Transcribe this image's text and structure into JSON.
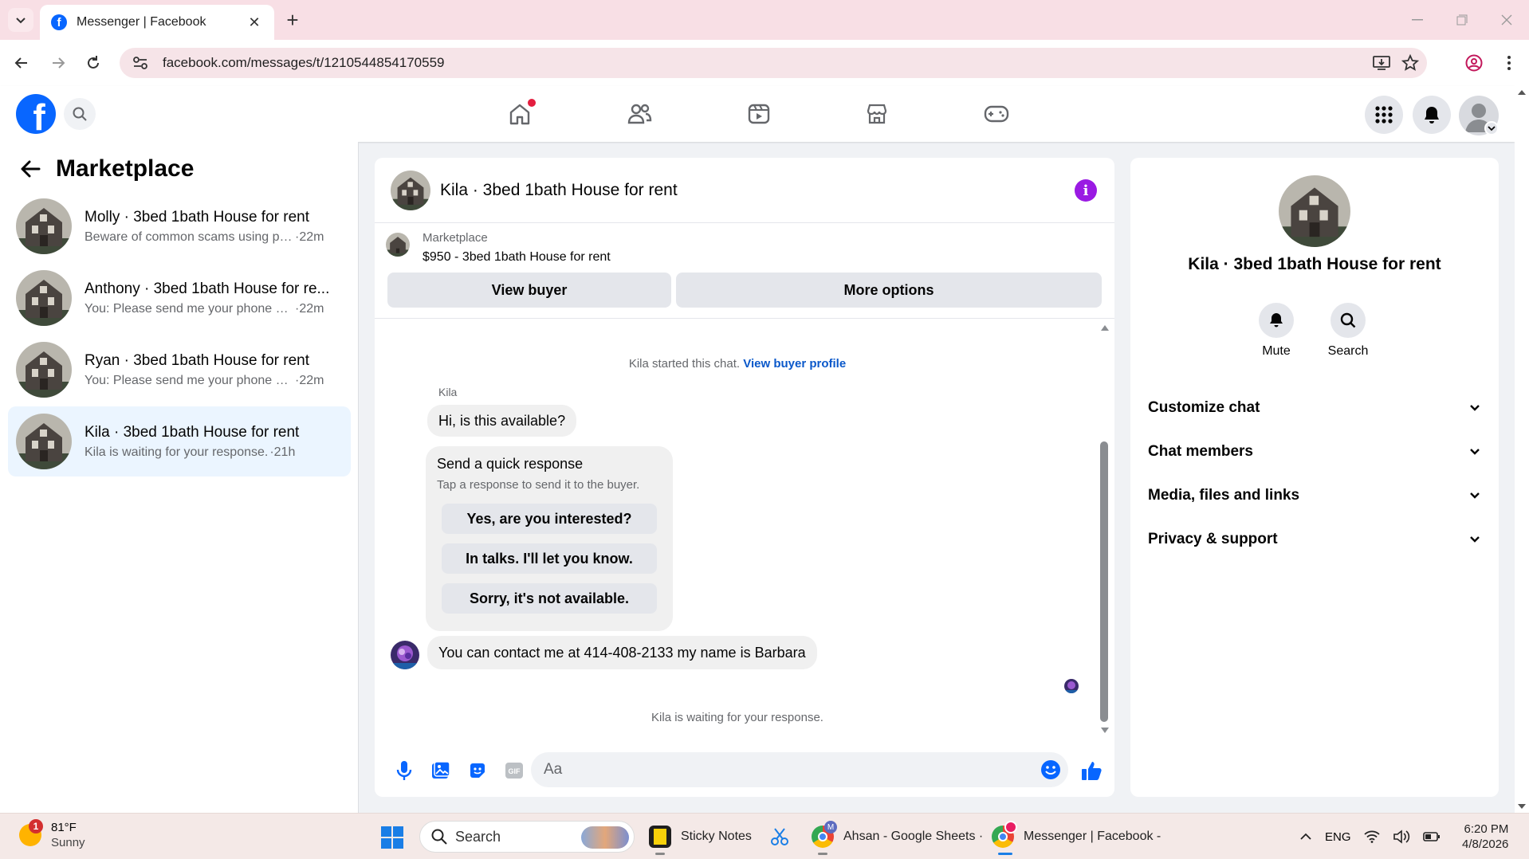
{
  "browser": {
    "tab_title": "Messenger | Facebook",
    "url": "facebook.com/messages/t/1210544854170559"
  },
  "left_panel": {
    "title": "Marketplace",
    "conversations": [
      {
        "name": "Molly · 3bed 1bath House for rent",
        "snippet": "Beware of common scams using pa...",
        "time": "·22m",
        "active": false
      },
      {
        "name": "Anthony · 3bed 1bath House for re...",
        "snippet": "You: Please send me your phone nu...",
        "time": "·22m",
        "active": false
      },
      {
        "name": "Ryan · 3bed 1bath House for rent",
        "snippet": "You: Please send me your phone nu...",
        "time": "·22m",
        "active": false
      },
      {
        "name": "Kila · 3bed 1bath House for rent",
        "snippet": "Kila is waiting for your response.",
        "time": "·21h",
        "active": true
      }
    ]
  },
  "chat": {
    "title": "Kila · 3bed 1bath House for rent",
    "listing_label": "Marketplace",
    "listing_price": "$950 - 3bed 1bath House for rent",
    "view_buyer": "View buyer",
    "more_options": "More options",
    "started_text": "Kila started this chat.",
    "view_profile_link": "View buyer profile",
    "sender_name": "Kila",
    "first_message": "Hi, is this available?",
    "quick_title": "Send a quick response",
    "quick_subtitle": "Tap a response to send it to the buyer.",
    "quick_options": [
      "Yes, are you interested?",
      "In talks. I'll let you know.",
      "Sorry, it's not available."
    ],
    "second_message": "You can contact me at 414-408-2133 my name is Barbara",
    "waiting_text": "Kila is waiting for your response.",
    "composer_placeholder": "Aa"
  },
  "right_panel": {
    "title": "Kila · 3bed 1bath House for rent",
    "actions": [
      "Mute",
      "Search"
    ],
    "sections": [
      "Customize chat",
      "Chat members",
      "Media, files and links",
      "Privacy & support"
    ]
  },
  "taskbar": {
    "weather_badge": "1",
    "temperature": "81°F",
    "condition": "Sunny",
    "search_label": "Search",
    "apps": [
      "Sticky Notes",
      "Ahsan - Google Sheets ·",
      "Messenger | Facebook -"
    ],
    "language": "ENG",
    "time": "6:20 PM",
    "date": "4/8/2026"
  },
  "colors": {
    "facebook_blue": "#0866ff",
    "info_purple": "#9a1ae3",
    "active_conversation": "#ebf5ff",
    "tabbar": "#f8dfe5",
    "link_blue": "#0a58ca"
  }
}
